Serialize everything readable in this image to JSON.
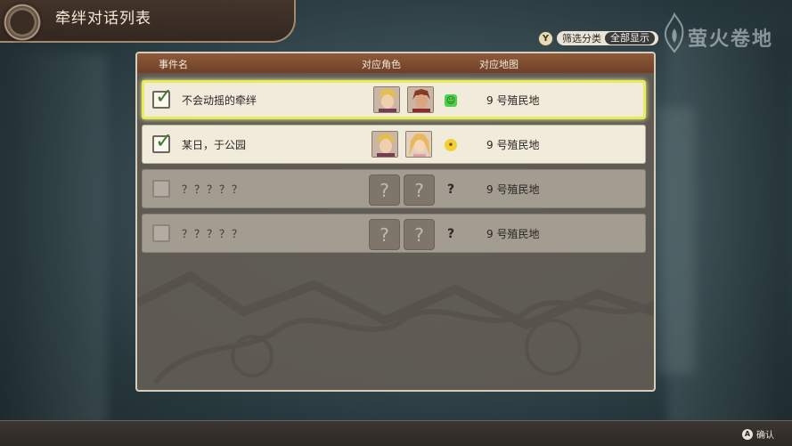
{
  "screen": {
    "title": "牵绊对话列表"
  },
  "filter": {
    "button_glyph": "Y",
    "label": "筛选分类",
    "value": "全部显示"
  },
  "watermark": {
    "text": "萤火卷地"
  },
  "table": {
    "headers": {
      "event": "事件名",
      "characters": "对应角色",
      "map": "对应地图"
    },
    "rows": [
      {
        "checked": true,
        "name": "不会动摇的牵绊",
        "characters": [
          "portrait-blond-hero",
          "portrait-redhair-warrior"
        ],
        "mood": "green",
        "mood_glyph": "☺",
        "map": "9 号殖民地",
        "selected": true
      },
      {
        "checked": true,
        "name": "某日，于公园",
        "characters": [
          "portrait-blond-hero",
          "portrait-blonde-girl"
        ],
        "mood": "yellow",
        "mood_glyph": "•",
        "map": "9 号殖民地",
        "selected": false
      },
      {
        "checked": false,
        "name": "？？？？？",
        "characters": [
          "?",
          "?"
        ],
        "mood": "unknown",
        "mood_glyph": "?",
        "map": "9 号殖民地",
        "selected": false
      },
      {
        "checked": false,
        "name": "？？？？？",
        "characters": [
          "?",
          "?"
        ],
        "mood": "unknown",
        "mood_glyph": "?",
        "map": "9 号殖民地",
        "selected": false
      }
    ]
  },
  "footer": {
    "button_glyph": "A",
    "label": "确认"
  },
  "colors": {
    "selection_border": "#e7ec5a",
    "header_bg": "#8d5a3a",
    "check_green": "#3f7a33"
  }
}
